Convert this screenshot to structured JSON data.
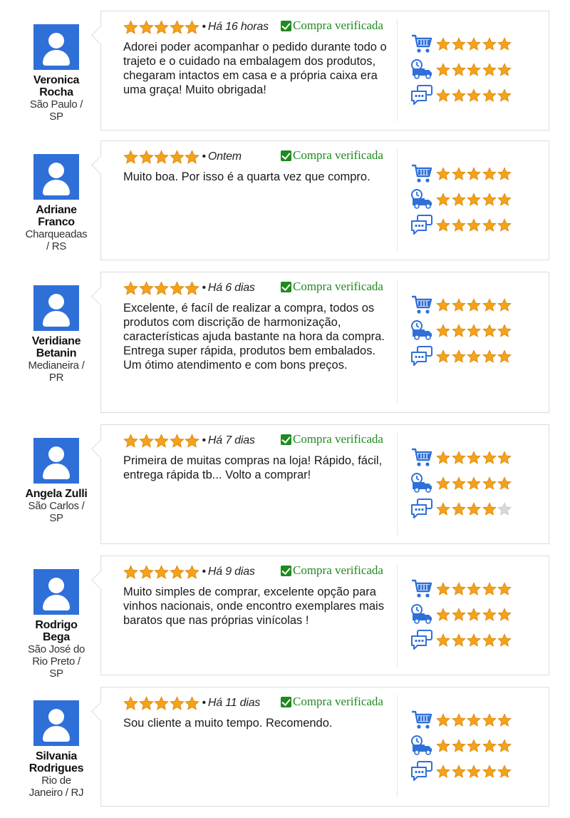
{
  "verified_label": "Compra verificada",
  "colors": {
    "accent_blue": "#2f6fd8",
    "verified_green": "#1f8a1f",
    "star_gold": "#f4a21b",
    "star_empty": "#d8d8d8"
  },
  "rating_icons": [
    "shopping-cart-icon",
    "delivery-truck-icon",
    "chat-bubbles-icon"
  ],
  "reviews": [
    {
      "name_lines": [
        "Veronica",
        "Rocha"
      ],
      "location_lines": [
        "São Paulo /",
        "SP"
      ],
      "stars": 5,
      "date": "Há 16 horas",
      "text": "Adorei poder acompanhar o pedido durante todo o trajeto e o cuidado na embalagem dos produtos, chegaram intactos em casa e a própria caixa era uma graça! Muito obrigada!",
      "ratings": [
        5,
        5,
        5
      ]
    },
    {
      "name_lines": [
        "Adriane",
        "Franco"
      ],
      "location_lines": [
        "Charqueadas",
        "/ RS"
      ],
      "stars": 5,
      "date": "Ontem",
      "text": "Muito boa. Por isso é a quarta vez que compro.",
      "ratings": [
        5,
        5,
        5
      ]
    },
    {
      "name_lines": [
        "Veridiane",
        "Betanin"
      ],
      "location_lines": [
        "Medianeira /",
        "PR"
      ],
      "stars": 5,
      "date": "Há 6 dias",
      "text": "Excelente, é facíl de realizar a compra, todos os produtos com discrição de harmonização, características ajuda bastante na hora da compra. Entrega super rápida, produtos bem embalados. Um ótimo atendimento e com bons preços.",
      "ratings": [
        5,
        5,
        5
      ]
    },
    {
      "name_lines": [
        "Angela Zulli"
      ],
      "location_lines": [
        "São Carlos /",
        "SP"
      ],
      "stars": 5,
      "date": "Há 7 dias",
      "text": "Primeira de muitas compras na loja! Rápido, fácil, entrega rápida tb... Volto a comprar!",
      "ratings": [
        5,
        5,
        4
      ]
    },
    {
      "name_lines": [
        "Rodrigo",
        "Bega"
      ],
      "location_lines": [
        "São José do",
        "Rio Preto /",
        "SP"
      ],
      "stars": 5,
      "date": "Há 9 dias",
      "text": "Muito simples de comprar, excelente opção para vinhos nacionais, onde encontro exemplares mais baratos que nas próprias vinícolas !",
      "ratings": [
        5,
        5,
        5
      ]
    },
    {
      "name_lines": [
        "Silvania",
        "Rodrigues"
      ],
      "location_lines": [
        "Rio de",
        "Janeiro / RJ"
      ],
      "stars": 5,
      "date": "Há 11 dias",
      "text": "Sou cliente a muito tempo. Recomendo.",
      "ratings": [
        5,
        5,
        5
      ]
    }
  ]
}
